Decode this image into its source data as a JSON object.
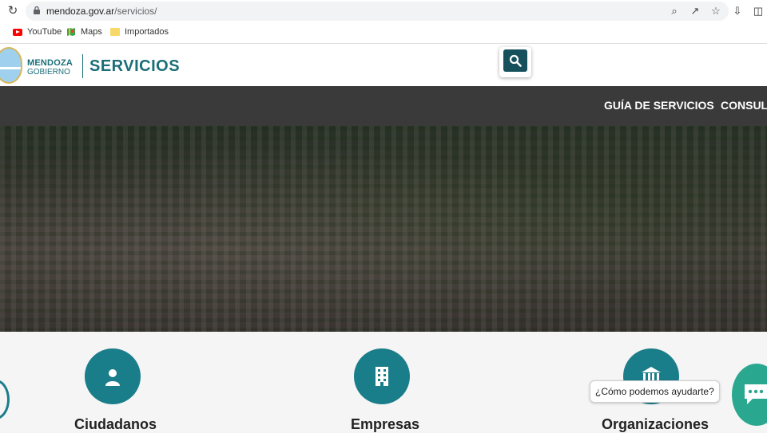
{
  "browser": {
    "url_domain": "mendoza.gov.ar",
    "url_path": "/servicios/"
  },
  "bookmarks": [
    {
      "label": "YouTube",
      "icon": "youtube-icon"
    },
    {
      "label": "Maps",
      "icon": "maps-icon"
    },
    {
      "label": "Importados",
      "icon": "folder-icon"
    }
  ],
  "header": {
    "brand_top": "MENDOZA",
    "brand_bottom": "GOBIERNO",
    "section_title": "SERVICIOS"
  },
  "nav": {
    "items": [
      "GUÍA DE SERVICIOS",
      "CONSULT"
    ]
  },
  "services": {
    "items": [
      {
        "label": "Ciudadanos",
        "icon": "person-icon"
      },
      {
        "label": "Empresas",
        "icon": "building-icon"
      },
      {
        "label": "Organizaciones",
        "icon": "institution-icon"
      }
    ]
  },
  "chat": {
    "prompt": "¿Cómo podemos ayudarte?"
  },
  "colors": {
    "brand": "#1a6e78",
    "accent": "#1a7d8a",
    "nav_bg": "#3a3a3a",
    "chat": "#2aa88f"
  }
}
